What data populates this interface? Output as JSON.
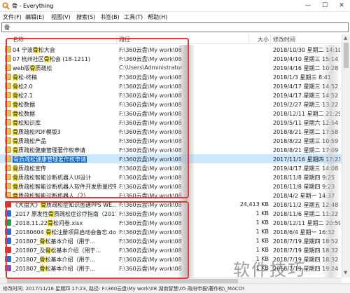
{
  "window": {
    "title": "骨 - Everything",
    "minimize": "—",
    "maximize": "☐",
    "close": "✕"
  },
  "menu": [
    "文件(F)",
    "编辑(E)",
    "视图(V)",
    "搜索(S)",
    "书签(B)",
    "工具(T)",
    "帮助(H)"
  ],
  "search": {
    "value": "骨"
  },
  "columns": {
    "name": "名称",
    "path": "路径",
    "size": "大小",
    "date": "修改时间"
  },
  "rows": [
    {
      "type": "folder",
      "name": "04 宁波骨松大会",
      "path": "F:\\360云盘\\My work\\08",
      "path2": "\\09 展会...",
      "size": "",
      "date": "2018/10/30 星期二 14:10"
    },
    {
      "type": "folder",
      "name": "07 杭州社区骨松会 (18-1211)",
      "path": "F:\\360云盘\\My work\\08",
      "path2": "\\09 展会...",
      "size": "",
      "date": "2019/4/10 星期三 15:14"
    },
    {
      "type": "folder",
      "name": "web版骨质疏松",
      "path": "C:\\Users\\Administrator",
      "path2": "nts\\Axur...",
      "size": "",
      "date": "2019/4/16 星期二 10:28"
    },
    {
      "type": "folder",
      "name": "骨松-终稿",
      "path": "F:\\360云盘\\My work\\08",
      "path2": "\\09 展会...",
      "size": "",
      "date": "2018/1/3 星期三 8:41"
    },
    {
      "type": "folder",
      "name": "骨松2.0",
      "path": "F:\\360云盘\\My work\\08",
      "path2": "\\09 展会...",
      "size": "",
      "date": "2019/4/17 星期三 14:52"
    },
    {
      "type": "folder",
      "name": "骨松2.1",
      "path": "F:\\360云盘\\My work\\08",
      "path2": "\\09 展会...",
      "size": "",
      "date": "2019/4/17 星期三 14:52"
    },
    {
      "type": "folder",
      "name": "骨松数据",
      "path": "F:\\360云盘\\My work\\08",
      "path2": "\\09 展会...",
      "size": "",
      "date": "2019/2/27 星期三 13:22"
    },
    {
      "type": "folder",
      "name": "骨松数据",
      "path": "F:\\360云盘\\My work\\08",
      "path2": "\\09 展会...",
      "size": "",
      "date": "2018/12/11 星期二 21:29"
    },
    {
      "type": "folder",
      "name": "骨松知识库",
      "path": "F:\\360云盘\\My work\\08",
      "path2": "\\09 展会...",
      "size": "",
      "date": "2019/5/11 星期六 12:54"
    },
    {
      "type": "folder",
      "name": "骨质疏松PDF模版3",
      "path": "F:\\360云盘\\My work\\08",
      "path2": "\\09 展会...",
      "size": "",
      "date": "2018/8/21 星期二 17:58"
    },
    {
      "type": "folder",
      "name": "骨质疏松产品",
      "path": "F:\\360云盘\\My work\\08",
      "path2": "\\09 展会...",
      "size": "",
      "date": "2018/8/22 星期三 10:59"
    },
    {
      "type": "folder",
      "name": "骨质疏松健康管理著作权申请",
      "path": "F:\\360云盘\\My work\\08",
      "path2": "\\05 政府...",
      "size": "",
      "date": "2018/8/21 星期二 17:09"
    },
    {
      "type": "folder",
      "name": "骨质疏松健康管理著作权申请",
      "path": "F:\\360云盘\\My work\\08",
      "path2": "\\05 政府...",
      "size": "",
      "date": "2017/11/16 星期四 17:23",
      "selected": true
    },
    {
      "type": "folder",
      "name": "骨质疏松宣传",
      "path": "F:\\360云盘\\My work\\08",
      "path2": "\\09 展会...",
      "size": "",
      "date": "2019/4/17 星期三 14:08"
    },
    {
      "type": "folder",
      "name": "骨质疏松智能诊断机器人UI设计",
      "path": "F:\\360云盘\\My work\\08",
      "path2": "\\05 政府...",
      "size": "",
      "date": "2018/11/8 星期四 9:25"
    },
    {
      "type": "folder",
      "name": "骨质疏松智能诊断机器人软件开发质量控制",
      "path": "F:\\360云盘\\My work\\08",
      "path2": "\\05 政府...",
      "size": "",
      "date": "2018/11/8 星期四 9:23"
    },
    {
      "type": "folder",
      "name": "骨质疏松智能诊断机器人（2）",
      "path": "F:\\360云盘\\My work\\08",
      "path2": "\\05 政府...",
      "size": "",
      "date": "2018/4/2 星期一 14:37"
    },
    {
      "type": "pdf",
      "name": "《大盘大》骨质疏松症知识图谱PPS WE...",
      "path": "F:\\360云盘\\My work\\08",
      "path2": "\\09 展会...",
      "size": "24,413 KB",
      "date": "2018/11/2 星期五 12:48"
    },
    {
      "type": "doc",
      "name": "_2017 原发性骨质疏松症诊疗指南（2017...",
      "path": "F:\\360云盘\\My work\\08",
      "path2": "\\09 展会...",
      "size": "1 KB",
      "date": "2018/11/6 星期二 11:22"
    },
    {
      "type": "xls",
      "name": "_2018.11.22骨松问卷.xlsx",
      "path": "F:\\360云盘\\My work\\08",
      "path2": "\\09 展会...",
      "size": "1 KB",
      "date": "2018/12/11 星期二 20:59"
    },
    {
      "type": "doc",
      "name": "_20180604 骨松注册项目启动会备忘.docx",
      "path": "F:\\360云盘\\My work\\08",
      "path2": "\\09 展会...",
      "size": "1 KB",
      "date": "2018/6/4 星期一 16:32"
    },
    {
      "type": "doc",
      "name": "_201807_骨松基本介绍（用于...",
      "path": "F:\\360云盘\\My work\\08",
      "path2": "\\09 展会...",
      "size": "1 KB",
      "date": "2018/7/19 星期四 18:52"
    },
    {
      "type": "pdf",
      "name": "_201807_及骨松基本介绍（用于...",
      "path": "F:\\360云盘\\My work\\08",
      "path2": "\\09 展会...",
      "size": "1 KB",
      "date": "2018/7/19 星期四 18:32"
    },
    {
      "type": "doc",
      "name": "_201807_骨松基本介绍（用于...",
      "path": "F:\\360云盘\\My work\\08",
      "path2": "\\09 展会...",
      "size": "1 KB",
      "date": "2018/7/19 星期四 18:32"
    },
    {
      "type": "rar",
      "name": "_201807_骨松基本介绍（用于...",
      "path": "F:\\360云盘\\My work\\08",
      "path2": "\\09 展会...",
      "size": "1 KB",
      "date": "2018/7/19 星期四 19:24"
    }
  ],
  "status": {
    "text": "修改时间: 2017/11/16 星期四 17:23, 路径: F:\\360云盘\\My work\\08 湖南智慧\\05 政府申报\\著作权\\_MACOS"
  },
  "watermark": "软件技巧",
  "colors": {
    "selection": "#cce8ff",
    "highlight": "#ffeb3b",
    "annotation": "#e53935"
  }
}
